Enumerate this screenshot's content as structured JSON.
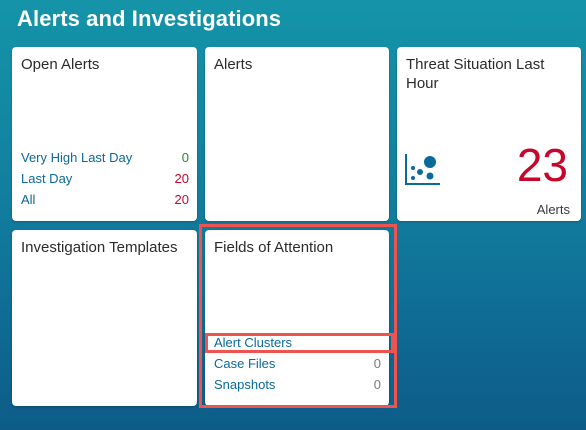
{
  "page": {
    "title": "Alerts and Investigations"
  },
  "tiles": {
    "open_alerts": {
      "title": "Open Alerts",
      "rows": [
        {
          "label": "Very High Last Day",
          "value": "0",
          "value_color": "#1e8a2e"
        },
        {
          "label": "Last Day",
          "value": "20",
          "value_color": "#c4072a"
        },
        {
          "label": "All",
          "value": "20",
          "value_color": "#c4072a"
        }
      ]
    },
    "alerts": {
      "title": "Alerts"
    },
    "threat_situation": {
      "title": "Threat Situation Last Hour",
      "value": "23",
      "unit": "Alerts",
      "icon": "scatter-chart-icon",
      "value_color": "#c4072a",
      "icon_color": "#0a6a9a"
    },
    "investigation_templates": {
      "title": "Investigation Templates"
    },
    "fields_of_attention": {
      "title": "Fields of Attention",
      "rows": [
        {
          "label": "Alert Clusters",
          "value": ""
        },
        {
          "label": "Case Files",
          "value": "0"
        },
        {
          "label": "Snapshots",
          "value": "0"
        }
      ]
    }
  },
  "colors": {
    "link": "#0a6a9a",
    "highlight": "#ef5350",
    "background_top": "#1594a8",
    "background_bottom": "#0d5c88"
  }
}
